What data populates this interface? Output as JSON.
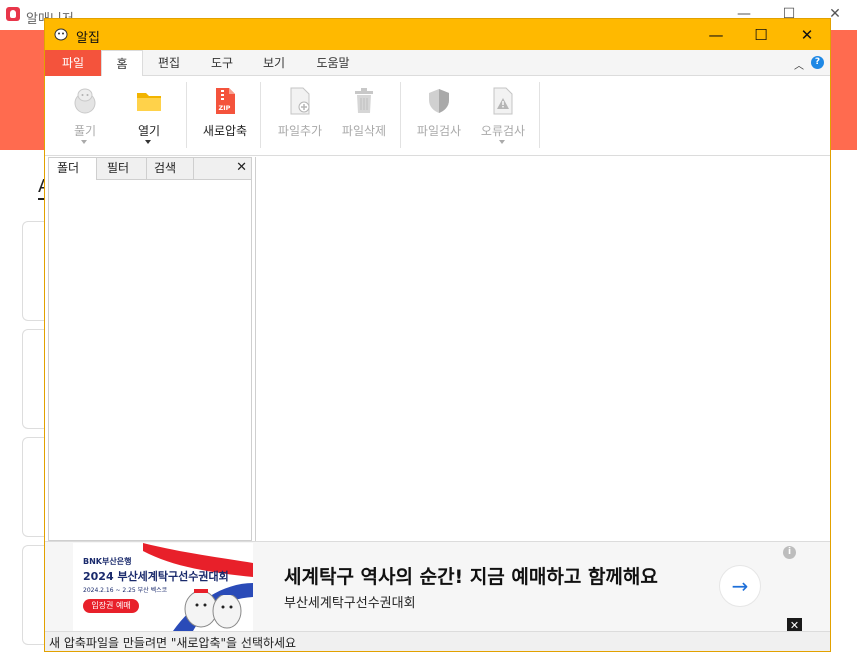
{
  "background_window": {
    "title": "알매니저",
    "first_letter": "A"
  },
  "window": {
    "title": "알집",
    "controls": {
      "minimize": "—",
      "maximize": "☐",
      "close": "✕"
    }
  },
  "menu_tabs": [
    {
      "label": "파일"
    },
    {
      "label": "홈"
    },
    {
      "label": "편집"
    },
    {
      "label": "도구"
    },
    {
      "label": "보기"
    },
    {
      "label": "도움말"
    }
  ],
  "ribbon": {
    "buttons": [
      {
        "label": "풀기",
        "icon": "extract-icon",
        "enabled": false
      },
      {
        "label": "열기",
        "icon": "folder-icon",
        "enabled": true
      },
      {
        "label": "새로압축",
        "icon": "zip-file-icon",
        "enabled": true
      },
      {
        "label": "파일추가",
        "icon": "add-file-icon",
        "enabled": false
      },
      {
        "label": "파일삭제",
        "icon": "trash-icon",
        "enabled": false
      },
      {
        "label": "파일검사",
        "icon": "shield-icon",
        "enabled": false
      },
      {
        "label": "오류검사",
        "icon": "warning-file-icon",
        "enabled": false
      }
    ],
    "zip_badge": "ZIP"
  },
  "folder_panel": {
    "tabs": [
      {
        "label": "폴더"
      },
      {
        "label": "필터"
      },
      {
        "label": "검색"
      }
    ],
    "close": "✕"
  },
  "ad": {
    "banner": {
      "sponsor": "BNK부산은행",
      "event": "2024 부산세계탁구선수권대회",
      "dates": "2024.2.16 ~ 2.25 부산 벡스코",
      "cta": "입장권 예매"
    },
    "headline": "세계탁구 역사의 순간! 지금 예매하고 함께해요",
    "subtext": "부산세계탁구선수권대회",
    "arrow": "→",
    "info": "i",
    "close": "✕"
  },
  "status": {
    "text": "새 압축파일을 만들려면 \"새로압축\"을 선택하세요"
  },
  "colors": {
    "titlebar": "#ffb900",
    "file_tab": "#f4533c",
    "hero": "#ff6b4f",
    "help": "#1e88e5"
  }
}
